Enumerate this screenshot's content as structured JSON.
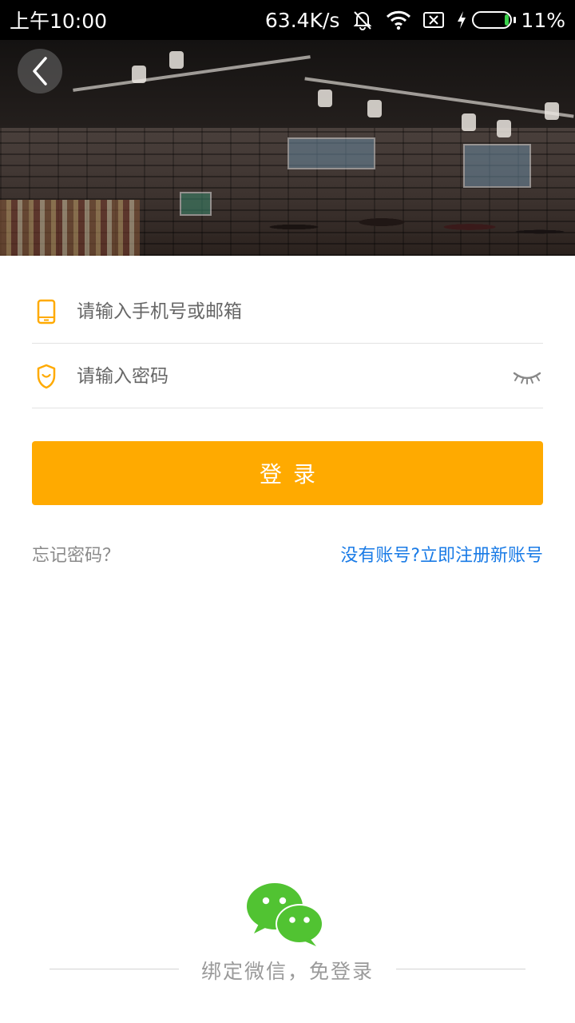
{
  "status_bar": {
    "time": "上午10:00",
    "network_speed": "63.4K/s",
    "battery_percent": "11%",
    "battery_level": 0.11,
    "icons": [
      "mute-bell-icon",
      "wifi-icon",
      "sim-off-icon",
      "charging-icon",
      "battery-icon"
    ]
  },
  "header": {
    "back_icon": "chevron-left-icon"
  },
  "form": {
    "account_placeholder": "请输入手机号或邮箱",
    "account_icon": "phone-icon",
    "password_placeholder": "请输入密码",
    "password_icon": "shield-icon",
    "toggle_visibility_icon": "eye-closed-icon",
    "login_label": "登录",
    "forgot_password": "忘记密码？",
    "register": "没有账号?立即注册新账号"
  },
  "wechat": {
    "icon": "wechat-icon",
    "label": "绑定微信，免登录"
  },
  "colors": {
    "accent": "#ffaa00",
    "link": "#1a7be6",
    "wechat_green": "#51c332"
  }
}
